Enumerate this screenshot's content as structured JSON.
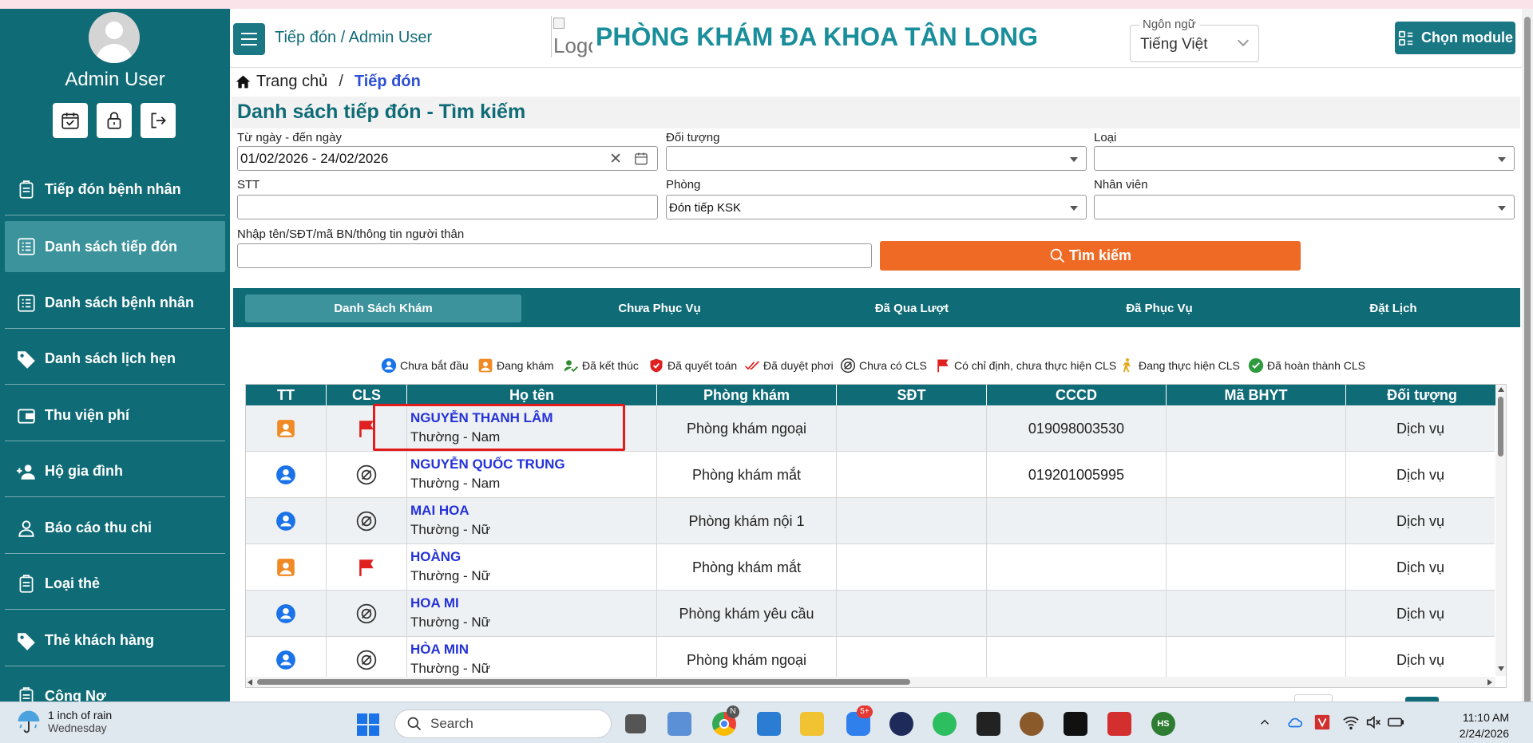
{
  "sidebar": {
    "user_name": "Admin User",
    "items": [
      {
        "label": "Tiếp đón bệnh nhân",
        "icon": "clipboard-icon"
      },
      {
        "label": "Danh sách tiếp đón",
        "icon": "list-icon",
        "active": true
      },
      {
        "label": "Danh sách bệnh nhân",
        "icon": "list-icon"
      },
      {
        "label": "Danh sách lịch hẹn",
        "icon": "tag-icon"
      },
      {
        "label": "Thu viện phí",
        "icon": "wallet-icon"
      },
      {
        "label": "Hộ gia đình",
        "icon": "add-user-icon"
      },
      {
        "label": "Báo cáo thu chi",
        "icon": "user-icon"
      },
      {
        "label": "Loại thẻ",
        "icon": "clipboard-icon"
      },
      {
        "label": "Thẻ khách hàng",
        "icon": "tag-icon"
      },
      {
        "label": "Công Nợ",
        "icon": "clipboard-icon"
      }
    ]
  },
  "header": {
    "crumb": "Tiếp đón / Admin User",
    "logo_alt": "Logo",
    "clinic_name": "PHÒNG KHÁM ĐA KHOA TÂN LONG",
    "language_label": "Ngôn ngữ",
    "language_value": "Tiếng Việt",
    "module_button": "Chọn module"
  },
  "breadcrumb": {
    "home": "Trang chủ",
    "sep": "/",
    "current": "Tiếp đón"
  },
  "page_title": "Danh sách tiếp đón - Tìm kiếm",
  "form": {
    "date_label": "Từ ngày - đến ngày",
    "date_value": "01/02/2026 - 24/02/2026",
    "doituong_label": "Đối tượng",
    "doituong_value": "",
    "loai_label": "Loại",
    "loai_value": "",
    "stt_label": "STT",
    "stt_value": "",
    "phong_label": "Phòng",
    "phong_value": "Đón tiếp KSK",
    "nhanvien_label": "Nhân viên",
    "nhanvien_value": "",
    "query_label": "Nhập tên/SĐT/mã BN/thông tin người thân",
    "query_value": "",
    "search_button": "Tìm kiếm"
  },
  "tabs": [
    "Danh Sách Khám",
    "Chưa Phục Vụ",
    "Đã Qua Lượt",
    "Đã Phục Vụ",
    "Đặt Lịch"
  ],
  "legend": [
    {
      "label": "Chưa bắt đầu",
      "icon": "user-circle-icon",
      "color": "#1a73e8"
    },
    {
      "label": "Đang khám",
      "icon": "user-square-icon",
      "color": "#f08a24"
    },
    {
      "label": "Đã kết thúc",
      "icon": "user-check-icon",
      "color": "#2e8b2e"
    },
    {
      "label": "Đã quyết toán",
      "icon": "shield-check-icon",
      "color": "#e02020"
    },
    {
      "label": "Đã duyệt phơi",
      "icon": "double-check-icon",
      "color": "#e02020"
    },
    {
      "label": "Chưa có CLS",
      "icon": "no-cls-icon",
      "color": "#333333"
    },
    {
      "label": "Có chỉ định, chưa thực hiện CLS",
      "icon": "red-flag-icon",
      "color": "#e02020"
    },
    {
      "label": "Đang thực hiện CLS",
      "icon": "walking-icon",
      "color": "#e6a817"
    },
    {
      "label": "Đã hoàn thành CLS",
      "icon": "check-circle-icon",
      "color": "#2e9b3e"
    }
  ],
  "table": {
    "columns": [
      "TT",
      "CLS",
      "Họ tên",
      "Phòng khám",
      "SĐT",
      "CCCD",
      "Mã BHYT",
      "Đối tượng"
    ],
    "rows": [
      {
        "tt": "in-progress",
        "cls": "flag",
        "name": "NGUYỄN THANH LÂM",
        "sub": "Thường - Nam",
        "room": "Phòng khám ngoại",
        "phone": "",
        "cccd": "019098003530",
        "bhyt": "",
        "type": "Dịch vụ"
      },
      {
        "tt": "not-started",
        "cls": "none",
        "name": "NGUYỄN QUỐC TRUNG",
        "sub": "Thường - Nam",
        "room": "Phòng khám mắt",
        "phone": "",
        "cccd": "019201005995",
        "bhyt": "",
        "type": "Dịch vụ"
      },
      {
        "tt": "not-started",
        "cls": "none",
        "name": "MAI HOA",
        "sub": "Thường - Nữ",
        "room": "Phòng khám nội 1",
        "phone": "",
        "cccd": "",
        "bhyt": "",
        "type": "Dịch vụ"
      },
      {
        "tt": "in-progress",
        "cls": "flag",
        "name": "HOÀNG",
        "sub": "Thường - Nữ",
        "room": "Phòng khám mắt",
        "phone": "",
        "cccd": "",
        "bhyt": "",
        "type": "Dịch vụ"
      },
      {
        "tt": "not-started",
        "cls": "none",
        "name": "HOA MI",
        "sub": "Thường - Nữ",
        "room": "Phòng khám yêu cầu",
        "phone": "",
        "cccd": "",
        "bhyt": "",
        "type": "Dịch vụ"
      },
      {
        "tt": "not-started",
        "cls": "none",
        "name": "HÒA MIN",
        "sub": "Thường - Nữ",
        "room": "Phòng khám ngoại",
        "phone": "",
        "cccd": "",
        "bhyt": "",
        "type": "Dịch vụ"
      }
    ]
  },
  "taskbar": {
    "weather_line1": "1 inch of rain",
    "weather_line2": "Wednesday",
    "search_placeholder": "Search",
    "zalo_badge": "5+",
    "chrome_badge": "N",
    "app_label_hs": "HS",
    "time": "11:10 AM",
    "date": "2/24/2026"
  },
  "colors": {
    "primary": "#0f6b76",
    "accent": "#ee6a25",
    "name_link": "#2432d8",
    "highlight_box": "#e31b1b"
  }
}
